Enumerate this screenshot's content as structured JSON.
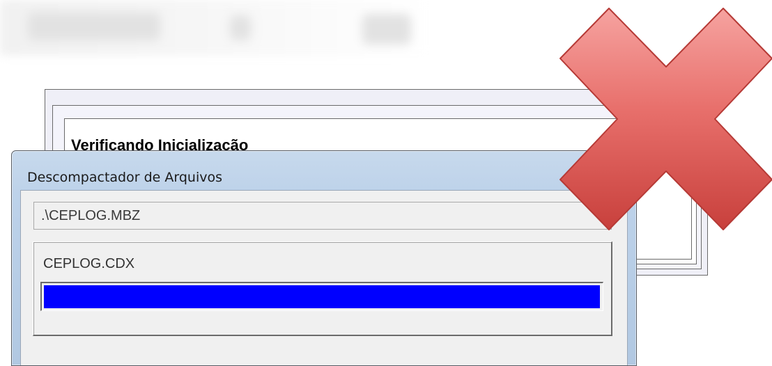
{
  "background_window": {
    "title": "Verificando Inicialização"
  },
  "dialog": {
    "title": "Descompactador de Arquivos",
    "archive_path": ".\\CEPLOG.MBZ",
    "current_file": "CEPLOG.CDX",
    "progress_fraction": 1.0,
    "progress_color": "#0000ff"
  },
  "overlay": {
    "icon": "red-x-icon",
    "color": "#d9534f"
  }
}
